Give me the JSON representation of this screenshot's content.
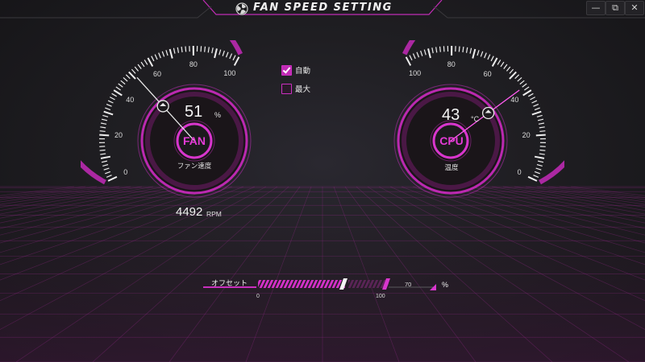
{
  "app": {
    "title": "FAN SPEED SETTING",
    "window_controls": {
      "minimize": "—",
      "restore": "⧉",
      "close": "✕"
    }
  },
  "fan_gauge": {
    "tick_labels": [
      "0",
      "20",
      "40",
      "60",
      "80",
      "100"
    ],
    "value": "51",
    "value_number": 51,
    "unit": "%",
    "center_label": "FAN",
    "sub_label": "ファン速度",
    "rpm_value": "4492",
    "rpm_unit": "RPM"
  },
  "cpu_gauge": {
    "tick_labels": [
      "100",
      "80",
      "60",
      "40",
      "20",
      "0"
    ],
    "value": "43",
    "value_number": 43,
    "unit": "°C",
    "center_label": "CPU",
    "sub_label": "温度"
  },
  "mode": {
    "auto": {
      "label": "自動",
      "checked": true
    },
    "max": {
      "label": "最大",
      "checked": false
    }
  },
  "offset": {
    "label": "オフセット",
    "scale_min": "0",
    "scale_max": "100",
    "value": "70",
    "unit": "%"
  },
  "colors": {
    "accent": "#d62fcf",
    "accent_bright": "#ff4cf0",
    "background": "#1d1c1f"
  }
}
